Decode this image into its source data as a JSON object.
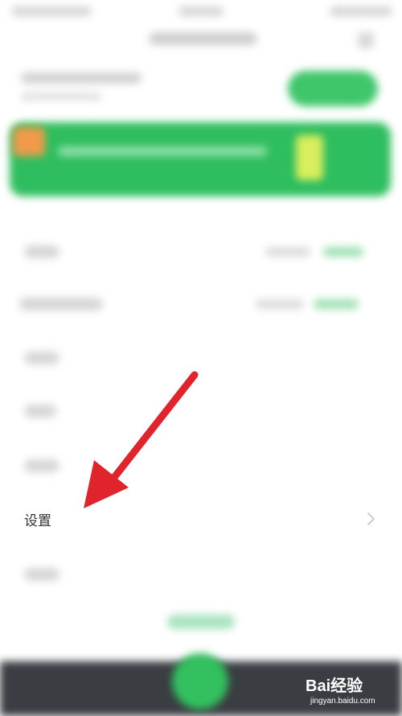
{
  "settings_row": {
    "label": "设置"
  },
  "watermark": {
    "brand": "Bai经验",
    "url": "jingyan.baidu.com"
  },
  "colors": {
    "accent_green": "#33c15f",
    "annotation_red": "#e0242c",
    "tabbar": "#3a3d42"
  },
  "icons": {
    "chevron": "chevron-right-icon",
    "arrow": "annotation-arrow"
  }
}
